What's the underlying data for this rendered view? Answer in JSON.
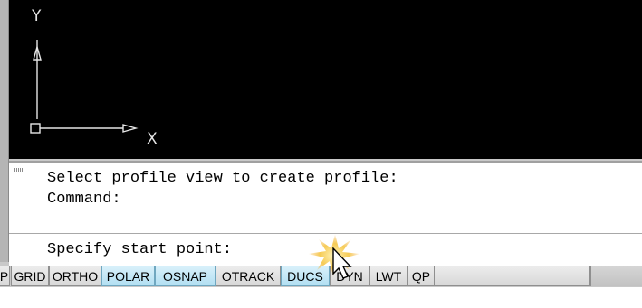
{
  "drawing": {
    "ucs_y_label": "Y",
    "ucs_x_label": "X"
  },
  "command_window": {
    "history": [
      "Select profile view to create profile:",
      "Command:"
    ],
    "prompt": "Specify start point:"
  },
  "status_bar": {
    "buttons": [
      {
        "label": "P",
        "state": "off"
      },
      {
        "label": "GRID",
        "state": "off"
      },
      {
        "label": "ORTHO",
        "state": "off"
      },
      {
        "label": "POLAR",
        "state": "on"
      },
      {
        "label": "OSNAP",
        "state": "on"
      },
      {
        "label": "OTRACK",
        "state": "off"
      },
      {
        "label": "DUCS",
        "state": "on"
      },
      {
        "label": "DYN",
        "state": "off"
      },
      {
        "label": "LWT",
        "state": "off"
      },
      {
        "label": "QP",
        "state": "off"
      }
    ]
  },
  "colors": {
    "drawing_background": "#000000",
    "toggle_on": "#b2dff2",
    "toggle_off": "#dedede"
  },
  "icons": [
    "ucs-icon",
    "grip-icon",
    "cursor-arrow-icon"
  ]
}
